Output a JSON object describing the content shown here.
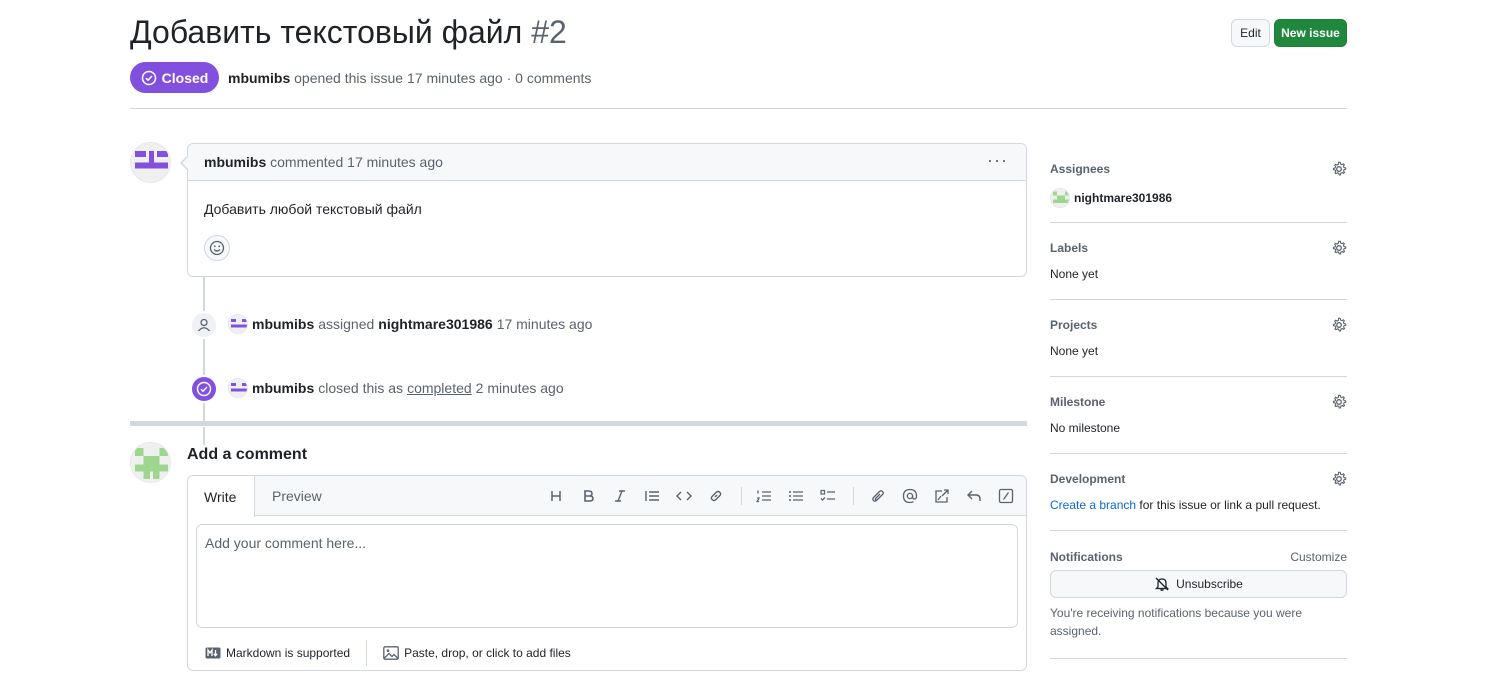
{
  "issue": {
    "title": "Добавить текстовый файл",
    "number": "#2",
    "state": "Closed",
    "author": "mbumibs",
    "meta_text": "opened this issue 17 minutes ago · 0 comments"
  },
  "actions": {
    "edit_label": "Edit",
    "new_issue_label": "New issue"
  },
  "comment": {
    "author": "mbumibs",
    "action": "commented",
    "time": "17 minutes ago",
    "body": "Добавить любой текстовый файл"
  },
  "timeline": {
    "assign": {
      "actor": "mbumibs",
      "verb": "assigned",
      "target": "nightmare301986",
      "time": "17 minutes ago"
    },
    "close": {
      "actor": "mbumibs",
      "verb": "closed this as",
      "reason": "completed",
      "time": "2 minutes ago"
    }
  },
  "add_comment": {
    "title": "Add a comment",
    "tabs": [
      "Write",
      "Preview"
    ],
    "placeholder": "Add your comment here...",
    "markdown_note": "Markdown is supported",
    "attach_note": "Paste, drop, or click to add files"
  },
  "sidebar": {
    "assignees": {
      "heading": "Assignees",
      "value": "nightmare301986"
    },
    "labels": {
      "heading": "Labels",
      "value": "None yet"
    },
    "projects": {
      "heading": "Projects",
      "value": "None yet"
    },
    "milestone": {
      "heading": "Milestone",
      "value": "No milestone"
    },
    "development": {
      "heading": "Development",
      "link": "Create a branch",
      "rest": " for this issue or link a pull request."
    },
    "notifications": {
      "heading": "Notifications",
      "customize": "Customize",
      "button": "Unsubscribe",
      "note": "You're receiving notifications because you were assigned."
    }
  },
  "colors": {
    "closed_purple": "#8250df",
    "primary_green": "#1f883d",
    "link_blue": "#0969da"
  }
}
